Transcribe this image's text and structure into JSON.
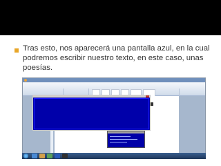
{
  "slide": {
    "bullet_text": "Tras esto, nos aparecerá una pantalla azul, en la cual podremos escribir nuestro texto, en este caso, unas poesías."
  },
  "colors": {
    "title_band": "#000000",
    "text": "#333333",
    "bullet": "#e8a628",
    "blue_screen": "#0000a8",
    "word_ribbon": "#dbe5f1"
  },
  "icons": {
    "bullet": "square-bullet",
    "cursor": "arrow-cursor"
  }
}
